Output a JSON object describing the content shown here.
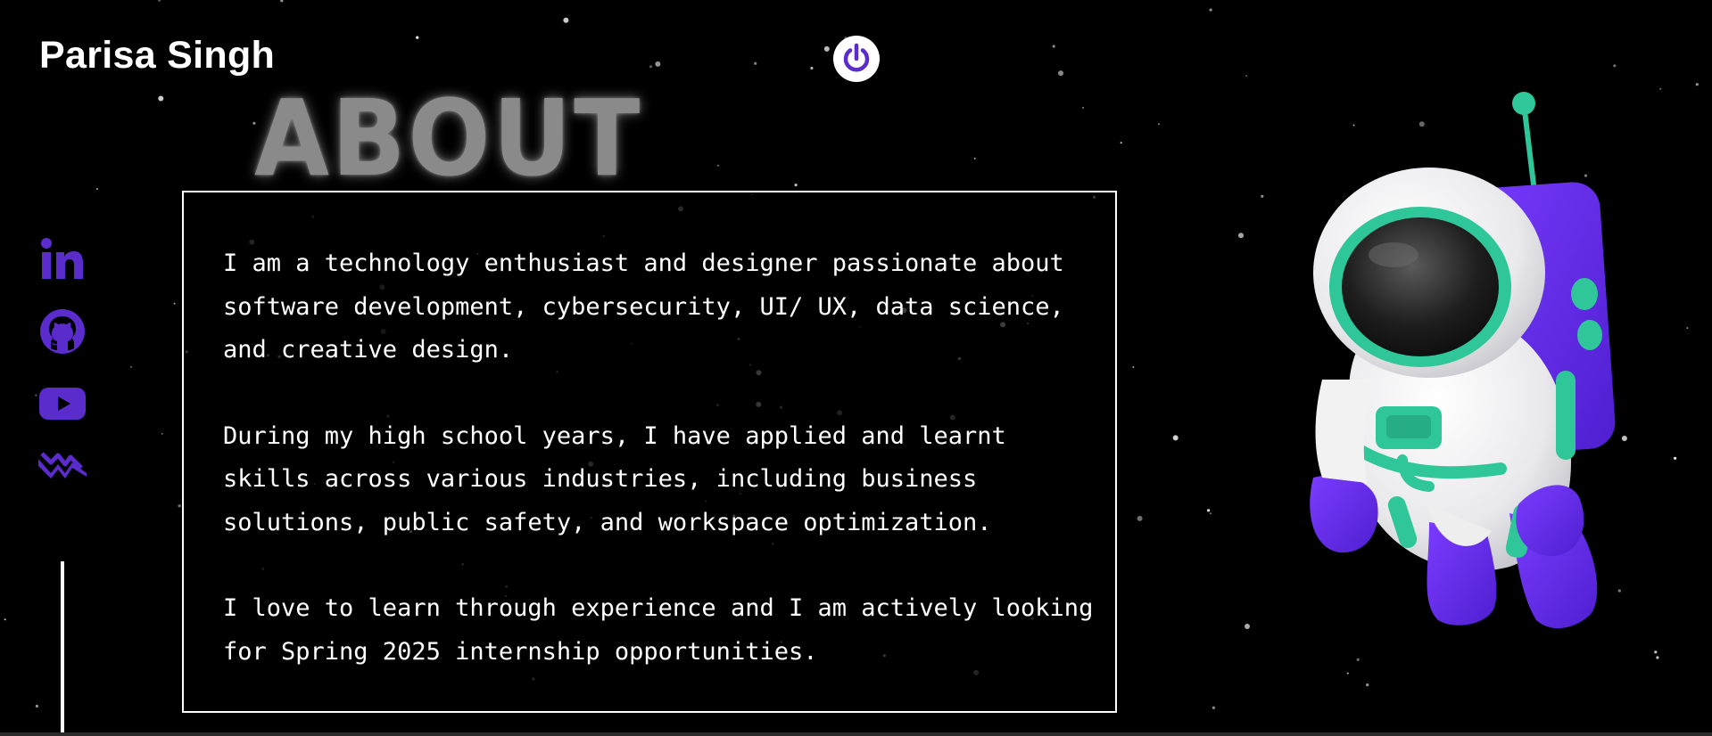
{
  "header": {
    "brand_name": "Parisa Singh",
    "power_icon": "power-icon"
  },
  "section": {
    "heading": "ABOUT",
    "paragraphs": [
      "I am a technology enthusiast and designer passionate about software development, cybersecurity, UI/ UX, data science, and creative design.",
      "During my high school years, I have applied and learnt skills across various industries, including business solutions, public safety, and workspace optimization.",
      "I love to learn through experience and I am actively looking for Spring 2025 internship opportunities."
    ]
  },
  "social_links": [
    {
      "icon": "linkedin-icon"
    },
    {
      "icon": "github-icon"
    },
    {
      "icon": "youtube-icon"
    },
    {
      "icon": "portfolio-logo-icon"
    }
  ],
  "colors": {
    "background": "#000000",
    "accent": "#5b2ccc",
    "heading": "#8a8a8a",
    "text": "#ffffff",
    "astronaut_teal": "#2fc79a",
    "astronaut_purple": "#6a2ef0"
  }
}
